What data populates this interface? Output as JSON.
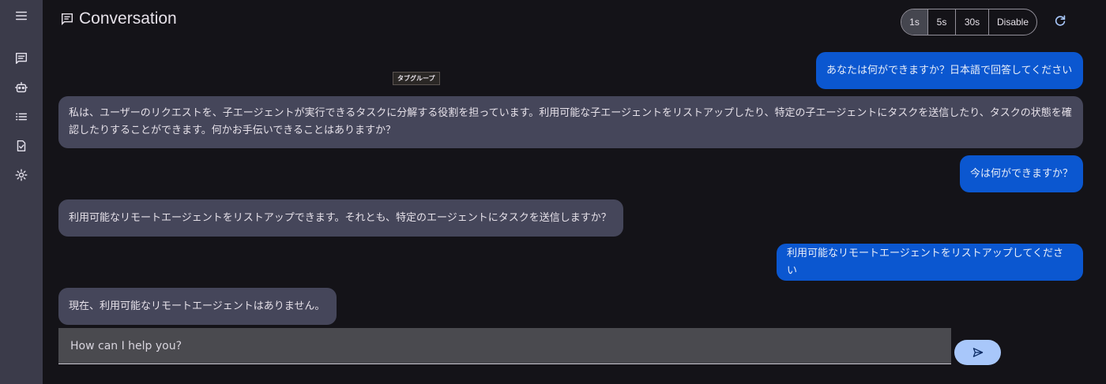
{
  "rail": {
    "icons": [
      "menu-icon",
      "chat-icon",
      "robot-icon",
      "list-icon",
      "task-icon",
      "settings-icon"
    ]
  },
  "header": {
    "title": "Conversation",
    "refresh": {
      "options": [
        "1s",
        "5s",
        "30s",
        "Disable"
      ],
      "selected": "1s"
    }
  },
  "tooltip": "タブグループ",
  "messages": [
    {
      "role": "user",
      "text": "あなたは何ができますか？日本語で回答してください"
    },
    {
      "role": "agent",
      "text": "私は、ユーザーのリクエストを、子エージェントが実行できるタスクに分解する役割を担っています。利用可能な子エージェントをリストアップしたり、特定の子エージェントにタスクを送信したり、タスクの状態を確認したりすることができます。何かお手伝いできることはありますか？"
    },
    {
      "role": "user",
      "text": "今は何ができますか？"
    },
    {
      "role": "agent",
      "text": "利用可能なリモートエージェントをリストアップできます。それとも、特定のエージェントにタスクを送信しますか？"
    },
    {
      "role": "user",
      "text": "利用可能なリモートエージェントをリストアップしてください"
    },
    {
      "role": "agent",
      "text": "現在、利用可能なリモートエージェントはありません。"
    }
  ],
  "composer": {
    "placeholder": "How can I help you?"
  },
  "colors": {
    "user_bubble": "#0b57d0",
    "agent_bubble": "#45465a",
    "send_button": "#a8c7fa",
    "rail": "#3b3b4a"
  }
}
